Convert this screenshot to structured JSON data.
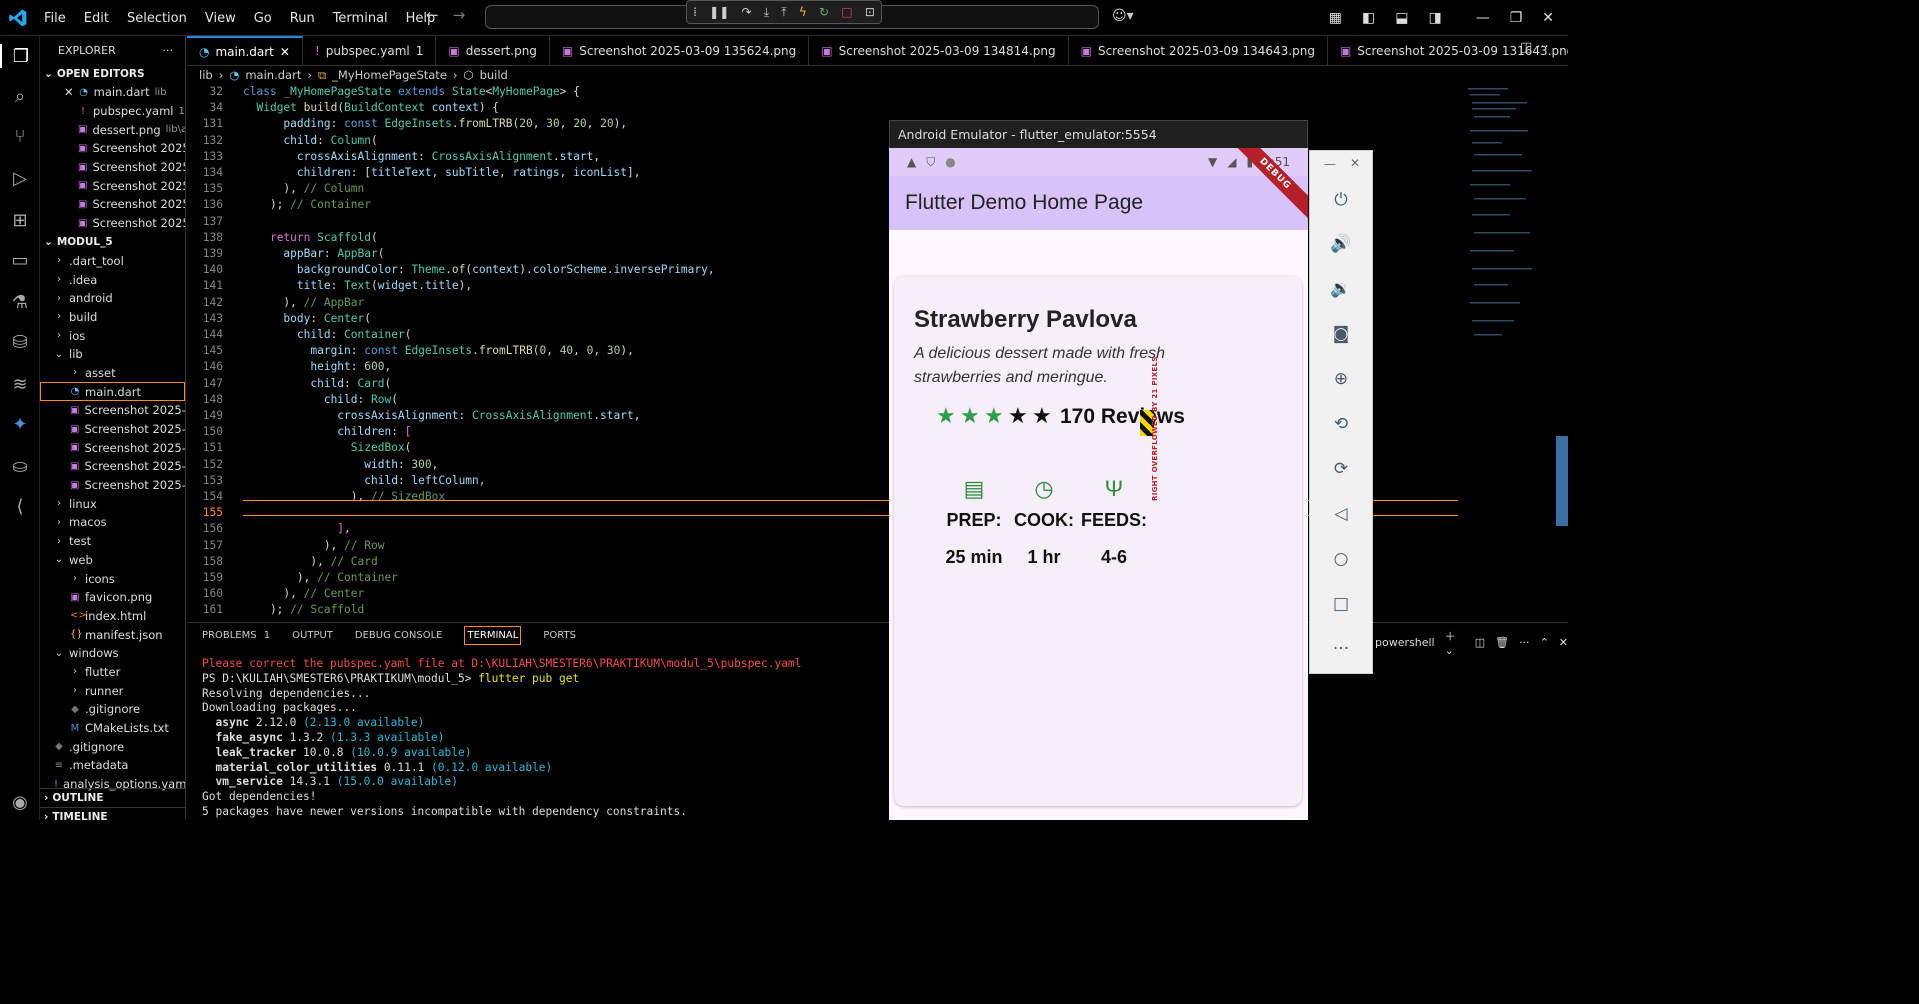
{
  "titlebar": {
    "menus": [
      "File",
      "Edit",
      "Selection",
      "View",
      "Go",
      "Run",
      "Terminal",
      "Help"
    ]
  },
  "tabs": [
    {
      "label": "main.dart",
      "active": true,
      "badge": ""
    },
    {
      "label": "pubspec.yaml",
      "badge": "1"
    },
    {
      "label": "dessert.png",
      "badge": ""
    },
    {
      "label": "Screenshot 2025-03-09 135624.png",
      "badge": ""
    },
    {
      "label": "Screenshot 2025-03-09 134814.png",
      "badge": ""
    },
    {
      "label": "Screenshot 2025-03-09 134643.png",
      "badge": ""
    },
    {
      "label": "Screenshot 2025-03-09 131643.png",
      "badge": ""
    },
    {
      "label": "Screenshot 2",
      "badge": ""
    }
  ],
  "breadcrumb": {
    "a": "lib",
    "b": "main.dart",
    "c": "_MyHomePageState",
    "d": "build"
  },
  "sidebar": {
    "title": "EXPLORER",
    "open_editors": "OPEN EDITORS",
    "open_files": [
      {
        "name": "main.dart",
        "hint": "lib"
      },
      {
        "name": "pubspec.yaml",
        "hint": "1"
      },
      {
        "name": "dessert.png",
        "hint": "lib\\a..."
      },
      {
        "name": "Screenshot 2025...",
        "hint": ""
      },
      {
        "name": "Screenshot 2025...",
        "hint": ""
      },
      {
        "name": "Screenshot 2025...",
        "hint": ""
      },
      {
        "name": "Screenshot 2025...",
        "hint": ""
      },
      {
        "name": "Screenshot 2025...",
        "hint": ""
      }
    ],
    "project": "MODUL_5",
    "tree": [
      {
        "name": ".dart_tool",
        "t": "folder",
        "d": 1
      },
      {
        "name": ".idea",
        "t": "folder",
        "d": 1
      },
      {
        "name": "android",
        "t": "folder",
        "d": 1
      },
      {
        "name": "build",
        "t": "folder",
        "d": 1
      },
      {
        "name": "ios",
        "t": "folder",
        "d": 1
      },
      {
        "name": "lib",
        "t": "open",
        "d": 1
      },
      {
        "name": "asset",
        "t": "folder",
        "d": 2
      },
      {
        "name": "main.dart",
        "t": "dart",
        "d": 2,
        "sel": true
      },
      {
        "name": "Screenshot 2025-03...",
        "t": "img",
        "d": 2
      },
      {
        "name": "Screenshot 2025-03...",
        "t": "img",
        "d": 2
      },
      {
        "name": "Screenshot 2025-03...",
        "t": "img",
        "d": 2
      },
      {
        "name": "Screenshot 2025-03...",
        "t": "img",
        "d": 2
      },
      {
        "name": "Screenshot 2025-03...",
        "t": "img",
        "d": 2
      },
      {
        "name": "linux",
        "t": "folder",
        "d": 1
      },
      {
        "name": "macos",
        "t": "folder",
        "d": 1
      },
      {
        "name": "test",
        "t": "folder",
        "d": 1
      },
      {
        "name": "web",
        "t": "open",
        "d": 1
      },
      {
        "name": "icons",
        "t": "folder",
        "d": 2
      },
      {
        "name": "favicon.png",
        "t": "img",
        "d": 2
      },
      {
        "name": "index.html",
        "t": "html",
        "d": 2
      },
      {
        "name": "manifest.json",
        "t": "json",
        "d": 2
      },
      {
        "name": "windows",
        "t": "open",
        "d": 1
      },
      {
        "name": "flutter",
        "t": "folder",
        "d": 2
      },
      {
        "name": "runner",
        "t": "folder",
        "d": 2
      },
      {
        "name": ".gitignore",
        "t": "git",
        "d": 2
      },
      {
        "name": "CMakeLists.txt",
        "t": "cmake",
        "d": 2
      },
      {
        "name": ".gitignore",
        "t": "git",
        "d": 1
      },
      {
        "name": ".metadata",
        "t": "file",
        "d": 1
      },
      {
        "name": "analysis_options.yaml",
        "t": "yaml",
        "d": 1
      }
    ],
    "outline": "OUTLINE",
    "timeline": "TIMELINE"
  },
  "editor": {
    "lines": [
      {
        "n": "32",
        "h": "<span class=\"kw\">class</span> <span class=\"ty\">_MyHomePageState</span> <span class=\"kw\">extends</span> <span class=\"ty\">State</span>&lt;<span class=\"ty\">MyHomePage</span>&gt; {"
      },
      {
        "n": "34",
        "h": "  <span class=\"ty\">Widget</span> <span class=\"fn\">build</span>(<span class=\"ty\">BuildContext</span> <span class=\"vr\">context</span>) {"
      },
      {
        "n": "131",
        "h": "      <span class=\"vr\">padding</span>: <span class=\"kw\">const</span> <span class=\"ty\">EdgeInsets</span>.<span class=\"fn\">fromLTRB</span>(<span class=\"nm\">20</span>, <span class=\"nm\">30</span>, <span class=\"nm\">20</span>, <span class=\"nm\">20</span>),"
      },
      {
        "n": "132",
        "h": "      <span class=\"vr\">child</span>: <span class=\"ty\">Column</span>("
      },
      {
        "n": "133",
        "h": "        <span class=\"vr\">crossAxisAlignment</span>: <span class=\"ty\">CrossAxisAlignment</span>.<span class=\"vr\">start</span>,"
      },
      {
        "n": "134",
        "h": "        <span class=\"vr\">children</span>: [<span class=\"vr\">titleText</span>, <span class=\"vr\">subTitle</span>, <span class=\"vr\">ratings</span>, <span class=\"vr\">iconList</span>],"
      },
      {
        "n": "135",
        "h": "      ), <span class=\"cm\">// Column</span>"
      },
      {
        "n": "136",
        "h": "    ); <span class=\"cm\">// Container</span>"
      },
      {
        "n": "137",
        "h": ""
      },
      {
        "n": "138",
        "h": "    <span class=\"pk\">return</span> <span class=\"ty\">Scaffold</span>("
      },
      {
        "n": "139",
        "h": "      <span class=\"vr\">appBar</span>: <span class=\"ty\">AppBar</span>("
      },
      {
        "n": "140",
        "h": "        <span class=\"vr\">backgroundColor</span>: <span class=\"ty\">Theme</span>.<span class=\"fn\">of</span>(<span class=\"vr\">context</span>).<span class=\"vr\">colorScheme</span>.<span class=\"vr\">inversePrimary</span>,"
      },
      {
        "n": "141",
        "h": "        <span class=\"vr\">title</span>: <span class=\"ty\">Text</span>(<span class=\"vr\">widget</span>.<span class=\"vr\">title</span>),"
      },
      {
        "n": "142",
        "h": "      ), <span class=\"cm\">// AppBar</span>"
      },
      {
        "n": "143",
        "h": "      <span class=\"vr\">body</span>: <span class=\"ty\">Center</span>("
      },
      {
        "n": "144",
        "h": "        <span class=\"vr\">child</span>: <span class=\"ty\">Container</span>("
      },
      {
        "n": "145",
        "h": "          <span class=\"vr\">margin</span>: <span class=\"kw\">const</span> <span class=\"ty\">EdgeInsets</span>.<span class=\"fn\">fromLTRB</span>(<span class=\"nm\">0</span>, <span class=\"nm\">40</span>, <span class=\"nm\">0</span>, <span class=\"nm\">30</span>),"
      },
      {
        "n": "146",
        "h": "          <span class=\"vr\">height</span>: <span class=\"nm\">600</span>,"
      },
      {
        "n": "147",
        "h": "          <span class=\"vr\">child</span>: <span class=\"ty\">Card</span>("
      },
      {
        "n": "148",
        "h": "            <span class=\"vr\">child</span>: <span class=\"ty\">Row</span>("
      },
      {
        "n": "149",
        "h": "              <span class=\"vr\">crossAxisAlignment</span>: <span class=\"ty\">CrossAxisAlignment</span>.<span class=\"vr\">start</span>,"
      },
      {
        "n": "150",
        "h": "              <span class=\"vr\">children</span>: <span class=\"pk\">[</span>"
      },
      {
        "n": "151",
        "h": "                <span class=\"ty\">SizedBox</span>("
      },
      {
        "n": "152",
        "h": "                  <span class=\"vr\">width</span>: <span class=\"nm\">300</span>,"
      },
      {
        "n": "153",
        "h": "                  <span class=\"vr\">child</span>: <span class=\"vr\">leftColumn</span>,"
      },
      {
        "n": "154",
        "h": "                ), <span class=\"cm\">// SizedBox</span>"
      },
      {
        "n": "155",
        "h": ""
      },
      {
        "n": "156",
        "h": "              <span class=\"pk\">]</span>,"
      },
      {
        "n": "157",
        "h": "            ), <span class=\"cm\">// Row</span>"
      },
      {
        "n": "158",
        "h": "          ), <span class=\"cm\">// Card</span>"
      },
      {
        "n": "159",
        "h": "        ), <span class=\"cm\">// Container</span>"
      },
      {
        "n": "160",
        "h": "      ), <span class=\"cm\">// Center</span>"
      },
      {
        "n": "161",
        "h": "    ); <span class=\"cm\">// Scaffold</span>"
      }
    ]
  },
  "panel": {
    "tabs": [
      "PROBLEMS",
      "OUTPUT",
      "DEBUG CONSOLE",
      "TERMINAL",
      "PORTS"
    ],
    "problems_count": "1",
    "shell": "powershell",
    "terminal": [
      {
        "c": "tred",
        "t": "Please correct the pubspec.yaml file at D:\\KULIAH\\SMESTER6\\PRAKTIKUM\\modul_5\\pubspec.yaml"
      },
      {
        "c": "",
        "t": "PS D:\\KULIAH\\SMESTER6\\PRAKTIKUM\\modul_5> ",
        "x": "flutter pub get"
      },
      {
        "c": "",
        "t": "Resolving dependencies..."
      },
      {
        "c": "",
        "t": "Downloading packages..."
      },
      {
        "c": "",
        "t": "  ",
        "b": "async",
        "r": " 2.12.0 ",
        "a": "(2.13.0 available)"
      },
      {
        "c": "",
        "t": "  ",
        "b": "fake_async",
        "r": " 1.3.2 ",
        "a": "(1.3.3 available)"
      },
      {
        "c": "",
        "t": "  ",
        "b": "leak_tracker",
        "r": " 10.0.8 ",
        "a": "(10.0.9 available)"
      },
      {
        "c": "",
        "t": "  ",
        "b": "material_color_utilities",
        "r": " 0.11.1 ",
        "a": "(0.12.0 available)"
      },
      {
        "c": "",
        "t": "  ",
        "b": "vm_service",
        "r": " 14.3.1 ",
        "a": "(15.0.0 available)"
      },
      {
        "c": "",
        "t": "Got dependencies!"
      },
      {
        "c": "",
        "t": "5 packages have newer versions incompatible with dependency constraints."
      }
    ]
  },
  "emulator": {
    "title": "Android Emulator - flutter_emulator:5554",
    "time": "2:51",
    "debug": "DEBUG",
    "appbar_title": "Flutter Demo Home Page",
    "dessert_title": "Strawberry Pavlova",
    "dessert_sub": "A delicious dessert made with fresh strawberries and meringue.",
    "rating_filled": 3,
    "rating_total": 5,
    "reviews": "170 Reviews",
    "overflow_msg": "RIGHT OVERFLOWED BY 21 PIXELS",
    "info": [
      {
        "label": "PREP:",
        "value": "25 min",
        "icon": "kitchen-icon"
      },
      {
        "label": "COOK:",
        "value": "1 hr",
        "icon": "timer-icon"
      },
      {
        "label": "FEEDS:",
        "value": "4-6",
        "icon": "restaurant-icon"
      }
    ]
  }
}
